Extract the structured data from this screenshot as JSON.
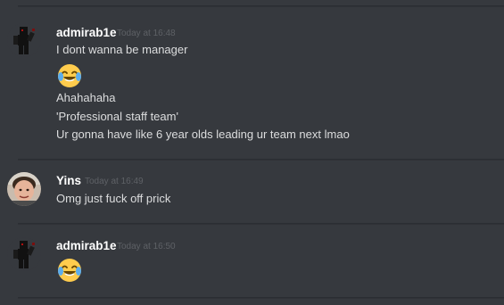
{
  "messages": [
    {
      "author": "admirab1e",
      "timestamp": "Today at 16:48",
      "avatar": "roblox-black-figure-avatar",
      "lines": [
        "I dont wanna be manager",
        "",
        "Ahahahaha",
        "'Professional staff team'",
        "Ur gonna have like 6 year olds leading ur team next lmao"
      ],
      "emoji": "joy-emoji"
    },
    {
      "author": "Yins",
      "timestamp": "Today at 16:49",
      "avatar": "photo-avatar",
      "lines": [
        "Omg just fuck off prick"
      ]
    },
    {
      "author": "admirab1e",
      "timestamp": "Today at 16:50",
      "avatar": "roblox-black-figure-avatar",
      "emoji": "joy-emoji"
    }
  ],
  "colors": {
    "background": "#36393e",
    "username": "#ffffff",
    "timestamp": "#5e6166",
    "message_text": "#dcddde"
  }
}
